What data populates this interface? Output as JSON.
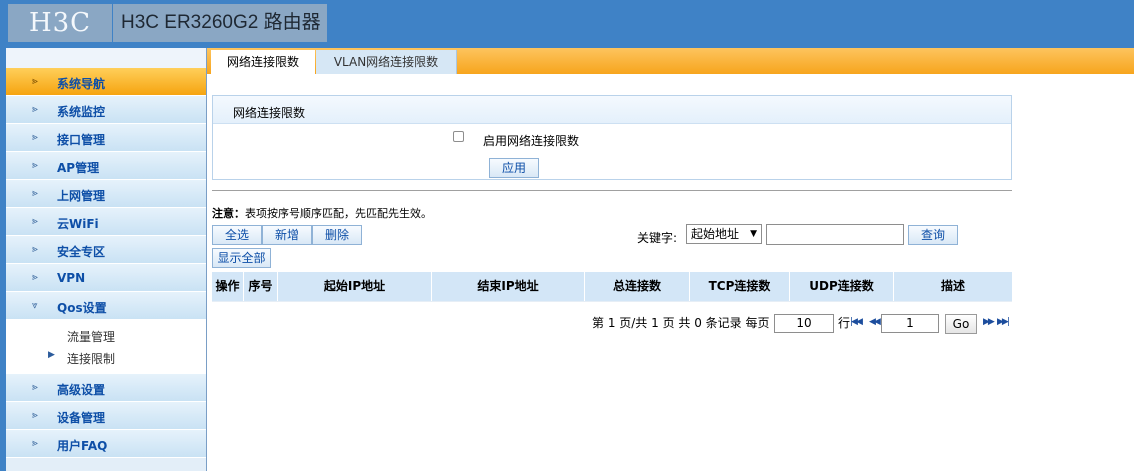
{
  "header": {
    "logo_text": "H3C",
    "title": "H3C ER3260G2 路由器"
  },
  "sidebar": {
    "items": [
      {
        "label": "系统导航",
        "active": true
      },
      {
        "label": "系统监控"
      },
      {
        "label": "接口管理"
      },
      {
        "label": "AP管理"
      },
      {
        "label": "上网管理"
      },
      {
        "label": "云WiFi"
      },
      {
        "label": "安全专区"
      },
      {
        "label": "VPN"
      },
      {
        "label": "Qos设置",
        "expanded": true
      }
    ],
    "subitems": [
      {
        "label": "流量管理"
      },
      {
        "label": "连接限制",
        "current": true
      }
    ],
    "items_after": [
      {
        "label": "高级设置"
      },
      {
        "label": "设备管理"
      },
      {
        "label": "用户FAQ"
      }
    ],
    "arrow_glyph": "⪢",
    "expanded_glyph": "⩔",
    "sub_marker": "▶"
  },
  "tabs": [
    {
      "label": "网络连接限数",
      "active": true
    },
    {
      "label": "VLAN网络连接限数"
    }
  ],
  "panel": {
    "title": "网络连接限数",
    "checkbox_label": "启用网络连接限数",
    "checkbox_checked": false,
    "apply_label": "应用"
  },
  "note": {
    "prefix": "注意：",
    "text": "表项按序号顺序匹配，先匹配先生效。"
  },
  "toolbar": {
    "select_all": "全选",
    "add": "新增",
    "delete": "删除",
    "show_all": "显示全部",
    "keyword_label": "关键字:",
    "keyword_selected": "起始地址",
    "keyword_value": "",
    "query": "查询"
  },
  "table": {
    "columns": [
      "操作",
      "序号",
      "起始IP地址",
      "结束IP地址",
      "总连接数",
      "TCP连接数",
      "UDP连接数",
      "描述"
    ],
    "rows": []
  },
  "pager": {
    "summary": "第 1 页/共 1 页 共 0 条记录 每页",
    "per_page": "10",
    "rows_unit": "行",
    "first": "⏮",
    "prev": "◀◀",
    "page": "1",
    "go": "Go",
    "next": "▶▶",
    "last": "⏭"
  },
  "colors": {
    "header_blue": "#3f82c6",
    "tab_orange": "#f7a51d",
    "link_blue": "#0e4fa7",
    "table_header": "#d3e6f7"
  }
}
